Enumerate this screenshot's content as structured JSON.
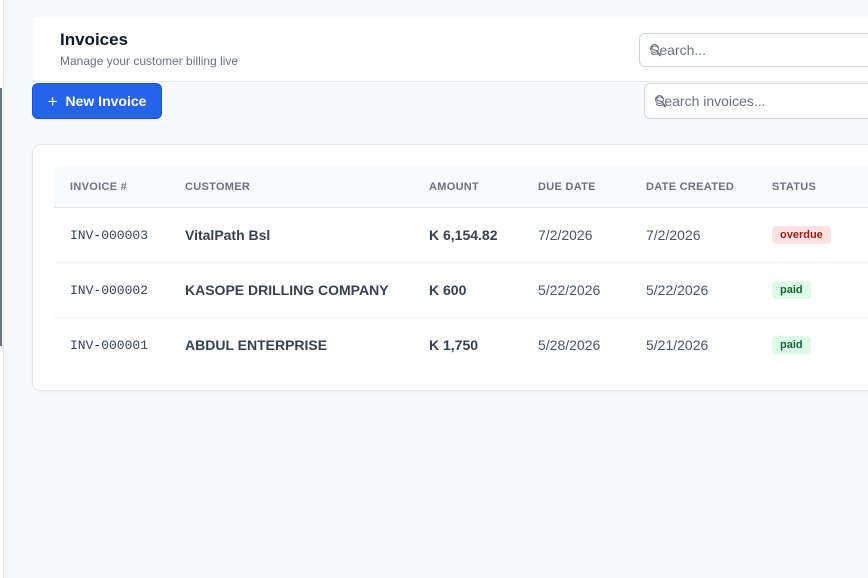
{
  "header": {
    "title": "Invoices",
    "subtitle": "Manage your customer billing live"
  },
  "search": {
    "placeholder": "Search..."
  },
  "toolbar": {
    "new_invoice_label": "New Invoice",
    "search_placeholder": "Search invoices..."
  },
  "icons": {
    "plus": "plus-icon",
    "search": "search-icon"
  },
  "colors": {
    "accent": "#2563eb",
    "overdue_bg": "#fde2e2",
    "overdue_text": "#991b1b",
    "paid_bg": "#dcfce7",
    "paid_text": "#166534"
  },
  "table": {
    "columns": [
      "INVOICE #",
      "CUSTOMER",
      "AMOUNT",
      "DUE DATE",
      "DATE CREATED",
      "STATUS"
    ],
    "rows": [
      {
        "invoice": "INV-000003",
        "customer": "VitalPath Bsl",
        "amount": "K 6,154.82",
        "due_date": "7/2/2026",
        "date_created": "7/2/2026",
        "status": "overdue"
      },
      {
        "invoice": "INV-000002",
        "customer": "KASOPE DRILLING COMPANY",
        "amount": "K 600",
        "due_date": "5/22/2026",
        "date_created": "5/22/2026",
        "status": "paid"
      },
      {
        "invoice": "INV-000001",
        "customer": "ABDUL ENTERPRISE",
        "amount": "K 1,750",
        "due_date": "5/28/2026",
        "date_created": "5/21/2026",
        "status": "paid"
      }
    ]
  }
}
